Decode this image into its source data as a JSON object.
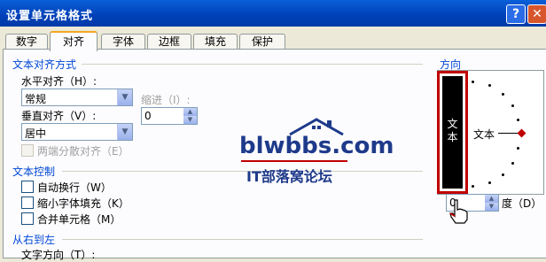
{
  "window": {
    "title": "设置单元格格式",
    "help_label": "?",
    "close_label": "✕"
  },
  "tabs": [
    "数字",
    "对齐",
    "字体",
    "边框",
    "填充",
    "保护"
  ],
  "alignment": {
    "group_title": "文本对齐方式",
    "horizontal_label": "水平对齐（H）:",
    "horizontal_value": "常规",
    "indent_label": "缩进（I）:",
    "indent_value": "0",
    "vertical_label": "垂直对齐（V）:",
    "vertical_value": "居中",
    "distributed_label": "两端分散对齐（E）"
  },
  "text_control": {
    "group_title": "文本控制",
    "wrap_label": "自动换行（W）",
    "shrink_label": "缩小字体填充（K）",
    "merge_label": "合并单元格（M）"
  },
  "rtl": {
    "group_title": "从右到左",
    "direction_label": "文字方向（T）:"
  },
  "orientation": {
    "group_title": "方向",
    "vertical_text": "文本",
    "dial_text": "文本",
    "degrees_value": "0",
    "degrees_label": "度（D）",
    "marker_color": "#c00000"
  },
  "watermark": {
    "site": "blwbbs.com",
    "forum": "IT部落窝论坛"
  }
}
